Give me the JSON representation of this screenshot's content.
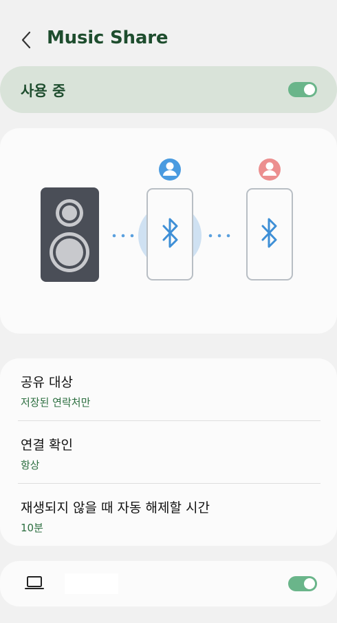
{
  "header": {
    "back_icon": "chevron-left-icon",
    "title": "Music Share"
  },
  "master_toggle": {
    "label": "사용 중",
    "on": true
  },
  "illustration": {
    "speaker_icon": "speaker-icon",
    "phone_icon": "phone-bluetooth-icon",
    "user1_icon": "person-icon",
    "user2_icon": "person-icon"
  },
  "settings": {
    "items": [
      {
        "title": "공유 대상",
        "value": "저장된 연락처만"
      },
      {
        "title": "연결 확인",
        "value": "항상"
      },
      {
        "title": "재생되지 않을 때 자동 해제할 시간",
        "value": "10분"
      }
    ]
  },
  "device": {
    "icon": "laptop-icon",
    "on": true
  },
  "colors": {
    "title_green": "#1e4d2e",
    "value_green": "#2b6e3f",
    "switch_on": "#6ab58a",
    "bluetooth_blue": "#3e8fd6",
    "user1_blue": "#4a9be0",
    "user2_pink": "#ec8f8f",
    "speaker_body": "#4a4e57"
  }
}
